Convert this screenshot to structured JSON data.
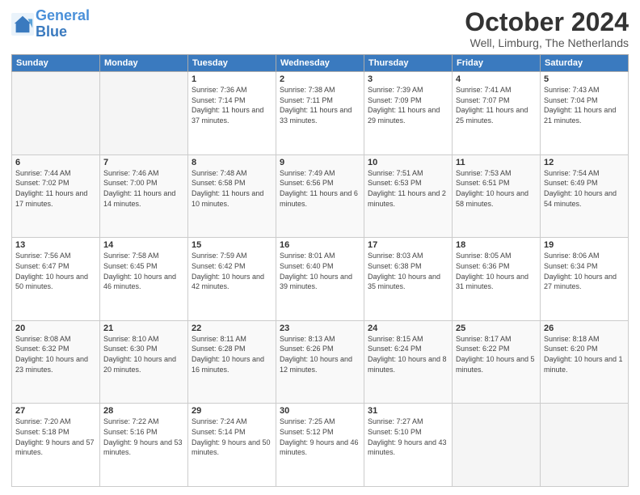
{
  "logo": {
    "line1": "General",
    "line2": "Blue"
  },
  "header": {
    "month": "October 2024",
    "location": "Well, Limburg, The Netherlands"
  },
  "weekdays": [
    "Sunday",
    "Monday",
    "Tuesday",
    "Wednesday",
    "Thursday",
    "Friday",
    "Saturday"
  ],
  "weeks": [
    [
      {
        "day": "",
        "details": ""
      },
      {
        "day": "",
        "details": ""
      },
      {
        "day": "1",
        "details": "Sunrise: 7:36 AM\nSunset: 7:14 PM\nDaylight: 11 hours and 37 minutes."
      },
      {
        "day": "2",
        "details": "Sunrise: 7:38 AM\nSunset: 7:11 PM\nDaylight: 11 hours and 33 minutes."
      },
      {
        "day": "3",
        "details": "Sunrise: 7:39 AM\nSunset: 7:09 PM\nDaylight: 11 hours and 29 minutes."
      },
      {
        "day": "4",
        "details": "Sunrise: 7:41 AM\nSunset: 7:07 PM\nDaylight: 11 hours and 25 minutes."
      },
      {
        "day": "5",
        "details": "Sunrise: 7:43 AM\nSunset: 7:04 PM\nDaylight: 11 hours and 21 minutes."
      }
    ],
    [
      {
        "day": "6",
        "details": "Sunrise: 7:44 AM\nSunset: 7:02 PM\nDaylight: 11 hours and 17 minutes."
      },
      {
        "day": "7",
        "details": "Sunrise: 7:46 AM\nSunset: 7:00 PM\nDaylight: 11 hours and 14 minutes."
      },
      {
        "day": "8",
        "details": "Sunrise: 7:48 AM\nSunset: 6:58 PM\nDaylight: 11 hours and 10 minutes."
      },
      {
        "day": "9",
        "details": "Sunrise: 7:49 AM\nSunset: 6:56 PM\nDaylight: 11 hours and 6 minutes."
      },
      {
        "day": "10",
        "details": "Sunrise: 7:51 AM\nSunset: 6:53 PM\nDaylight: 11 hours and 2 minutes."
      },
      {
        "day": "11",
        "details": "Sunrise: 7:53 AM\nSunset: 6:51 PM\nDaylight: 10 hours and 58 minutes."
      },
      {
        "day": "12",
        "details": "Sunrise: 7:54 AM\nSunset: 6:49 PM\nDaylight: 10 hours and 54 minutes."
      }
    ],
    [
      {
        "day": "13",
        "details": "Sunrise: 7:56 AM\nSunset: 6:47 PM\nDaylight: 10 hours and 50 minutes."
      },
      {
        "day": "14",
        "details": "Sunrise: 7:58 AM\nSunset: 6:45 PM\nDaylight: 10 hours and 46 minutes."
      },
      {
        "day": "15",
        "details": "Sunrise: 7:59 AM\nSunset: 6:42 PM\nDaylight: 10 hours and 42 minutes."
      },
      {
        "day": "16",
        "details": "Sunrise: 8:01 AM\nSunset: 6:40 PM\nDaylight: 10 hours and 39 minutes."
      },
      {
        "day": "17",
        "details": "Sunrise: 8:03 AM\nSunset: 6:38 PM\nDaylight: 10 hours and 35 minutes."
      },
      {
        "day": "18",
        "details": "Sunrise: 8:05 AM\nSunset: 6:36 PM\nDaylight: 10 hours and 31 minutes."
      },
      {
        "day": "19",
        "details": "Sunrise: 8:06 AM\nSunset: 6:34 PM\nDaylight: 10 hours and 27 minutes."
      }
    ],
    [
      {
        "day": "20",
        "details": "Sunrise: 8:08 AM\nSunset: 6:32 PM\nDaylight: 10 hours and 23 minutes."
      },
      {
        "day": "21",
        "details": "Sunrise: 8:10 AM\nSunset: 6:30 PM\nDaylight: 10 hours and 20 minutes."
      },
      {
        "day": "22",
        "details": "Sunrise: 8:11 AM\nSunset: 6:28 PM\nDaylight: 10 hours and 16 minutes."
      },
      {
        "day": "23",
        "details": "Sunrise: 8:13 AM\nSunset: 6:26 PM\nDaylight: 10 hours and 12 minutes."
      },
      {
        "day": "24",
        "details": "Sunrise: 8:15 AM\nSunset: 6:24 PM\nDaylight: 10 hours and 8 minutes."
      },
      {
        "day": "25",
        "details": "Sunrise: 8:17 AM\nSunset: 6:22 PM\nDaylight: 10 hours and 5 minutes."
      },
      {
        "day": "26",
        "details": "Sunrise: 8:18 AM\nSunset: 6:20 PM\nDaylight: 10 hours and 1 minute."
      }
    ],
    [
      {
        "day": "27",
        "details": "Sunrise: 7:20 AM\nSunset: 5:18 PM\nDaylight: 9 hours and 57 minutes."
      },
      {
        "day": "28",
        "details": "Sunrise: 7:22 AM\nSunset: 5:16 PM\nDaylight: 9 hours and 53 minutes."
      },
      {
        "day": "29",
        "details": "Sunrise: 7:24 AM\nSunset: 5:14 PM\nDaylight: 9 hours and 50 minutes."
      },
      {
        "day": "30",
        "details": "Sunrise: 7:25 AM\nSunset: 5:12 PM\nDaylight: 9 hours and 46 minutes."
      },
      {
        "day": "31",
        "details": "Sunrise: 7:27 AM\nSunset: 5:10 PM\nDaylight: 9 hours and 43 minutes."
      },
      {
        "day": "",
        "details": ""
      },
      {
        "day": "",
        "details": ""
      }
    ]
  ]
}
